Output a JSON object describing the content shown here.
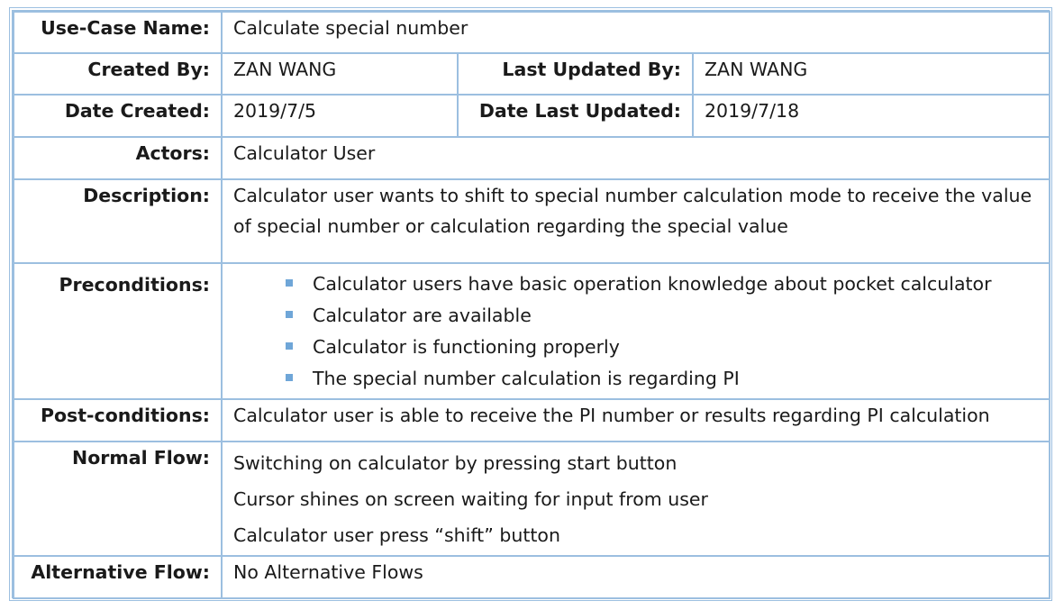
{
  "use_case_name": {
    "label": "Use-Case Name:",
    "value": "Calculate special number"
  },
  "created_by": {
    "label": "Created By:",
    "value": "ZAN WANG"
  },
  "last_updated_by": {
    "label": "Last Updated By:",
    "value": "ZAN WANG"
  },
  "date_created": {
    "label": "Date Created:",
    "value": "2019/7/5"
  },
  "date_last_updated": {
    "label": "Date Last Updated:",
    "value": "2019/7/18"
  },
  "actors": {
    "label": "Actors:",
    "value": "Calculator User"
  },
  "description": {
    "label": "Description:",
    "value": "Calculator user wants to shift to special number calculation mode to receive the value of special number or calculation regarding the special value"
  },
  "preconditions": {
    "label": "Preconditions:",
    "items": [
      "Calculator users have basic operation knowledge about pocket calculator",
      "Calculator are available",
      "Calculator is functioning properly",
      "The special number calculation is regarding PI"
    ]
  },
  "postconditions": {
    "label": "Post-conditions:",
    "value": "Calculator user is able to receive the PI number or results regarding PI calculation"
  },
  "normal_flow": {
    "label": "Normal Flow:",
    "steps": [
      "Switching on calculator by pressing start button",
      "Cursor shines on screen waiting for input from user",
      "Calculator user press “shift” button"
    ]
  },
  "alternative_flow": {
    "label": "Alternative Flow:",
    "value": "No Alternative Flows"
  },
  "colors": {
    "border": "#9cbfe0",
    "bullet": "#6fa6d8"
  }
}
